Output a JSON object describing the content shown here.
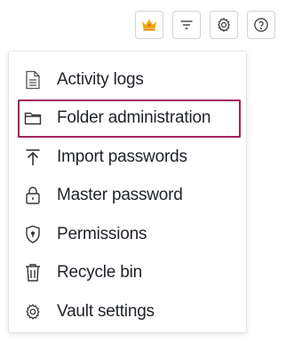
{
  "toolbar": {
    "buttons": [
      {
        "icon": "crown-icon",
        "color": "#f0a800"
      },
      {
        "icon": "filter-lines-icon"
      },
      {
        "icon": "gear-icon"
      },
      {
        "icon": "help-circle-icon"
      }
    ]
  },
  "menu": {
    "items": [
      {
        "label": "Activity logs",
        "icon": "document-icon"
      },
      {
        "label": "Folder administration",
        "icon": "folder-icon",
        "selected": true
      },
      {
        "label": "Import passwords",
        "icon": "upload-arrow-icon"
      },
      {
        "label": "Master password",
        "icon": "lock-icon"
      },
      {
        "label": "Permissions",
        "icon": "shield-icon"
      },
      {
        "label": "Recycle bin",
        "icon": "trash-icon"
      },
      {
        "label": "Vault settings",
        "icon": "gear-icon"
      }
    ],
    "highlight_color": "#a3245a"
  }
}
